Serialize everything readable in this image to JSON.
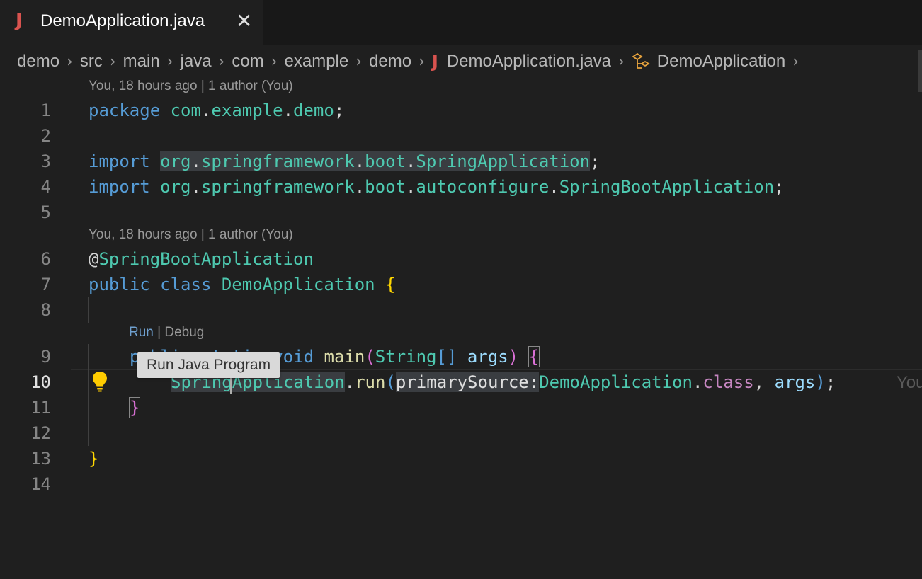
{
  "tab": {
    "label": "DemoApplication.java",
    "icon": "java-file-icon",
    "close": "✕"
  },
  "breadcrumb": {
    "items": [
      "demo",
      "src",
      "main",
      "java",
      "com",
      "example",
      "demo"
    ],
    "file": "DemoApplication.java",
    "symbol": "DemoApplication"
  },
  "lens": {
    "blame1": "You, 18 hours ago | 1 author (You)",
    "blame2": "You, 18 hours ago | 1 author (You)",
    "run": "Run",
    "divider": " | ",
    "debug": "Debug"
  },
  "line_numbers": [
    "1",
    "2",
    "3",
    "4",
    "5",
    "6",
    "7",
    "8",
    "9",
    "10",
    "11",
    "12",
    "13",
    "14"
  ],
  "code": {
    "l1": {
      "kw": "package",
      "p1": "com",
      "d1": ".",
      "p2": "example",
      "d2": ".",
      "p3": "demo",
      "semi": ";"
    },
    "l3": {
      "kw": "import",
      "p1": "org",
      "d1": ".",
      "p2": "springframework",
      "d2": ".",
      "p3": "boot",
      "d3": ".",
      "cls": "SpringApplication",
      "semi": ";"
    },
    "l4": {
      "kw": "import",
      "p1": "org",
      "d1": ".",
      "p2": "springframework",
      "d2": ".",
      "p3": "boot",
      "d3": ".",
      "p4": "autoconfigure",
      "d4": ".",
      "cls": "SpringBootApplication",
      "semi": ";"
    },
    "l6": {
      "at": "@",
      "ann": "SpringBootApplication"
    },
    "l7": {
      "kw1": "public",
      "kw2": "class",
      "cls": "DemoApplication",
      "brace": "{"
    },
    "l9": {
      "hidden": "public static void ",
      "fn": "main",
      "open": "(",
      "ty": "String",
      "arr": "[]",
      "arg": "args",
      "close": ")",
      "brace": "{"
    },
    "l10": {
      "cls": "SpringApplication",
      "dot": ".",
      "fn": "run",
      "open": "(",
      "hint": "primarySource:",
      "cls2": "DemoApplication",
      "dot2": ".",
      "kw": "class",
      "comma": ", ",
      "arg": "args",
      "close": ")",
      "semi": ";"
    },
    "l11": {
      "brace": "}"
    },
    "l13": {
      "brace": "}"
    },
    "ghost": "You"
  },
  "tooltip": "Run Java Program",
  "colors": {
    "keyword": "#569cd6",
    "type": "#4ec9b0",
    "function": "#dcdcaa",
    "variable": "#9cdcfe",
    "java_icon": "#d9534f"
  }
}
